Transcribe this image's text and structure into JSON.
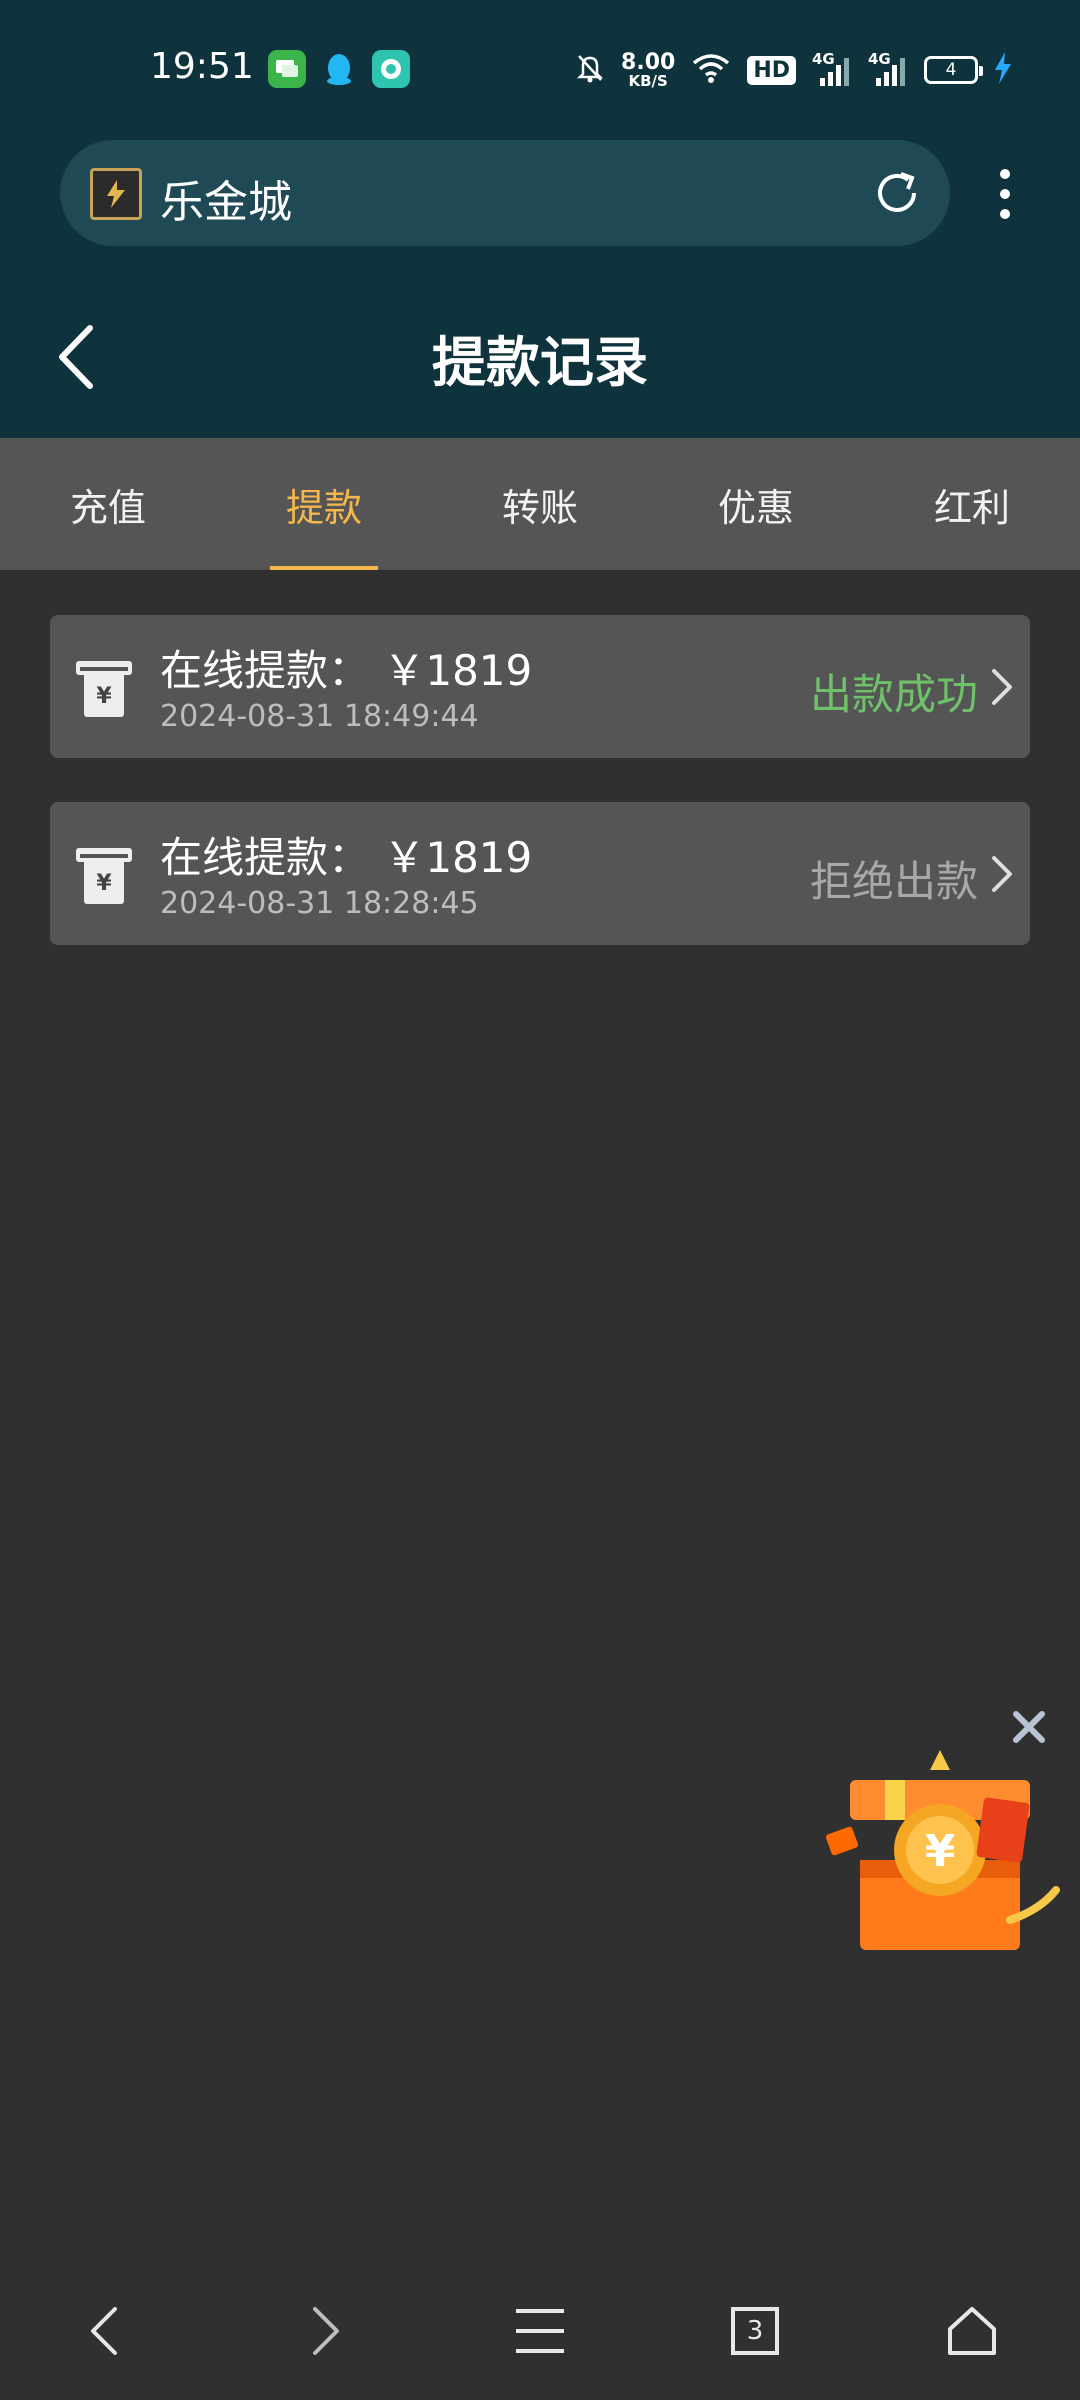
{
  "status_bar": {
    "time": "19:51",
    "net_speed_value": "8.00",
    "net_speed_unit": "KB/S",
    "hd_label": "HD",
    "sim1_label": "4G",
    "sim2_label": "4G",
    "battery": "4",
    "notification_icons": [
      "message-app-icon",
      "qq-icon",
      "chat-app-icon"
    ]
  },
  "browser": {
    "site_name": "乐金城",
    "tab_count": "3"
  },
  "page": {
    "title": "提款记录"
  },
  "tabs": [
    {
      "label": "充值",
      "active": false
    },
    {
      "label": "提款",
      "active": true
    },
    {
      "label": "转账",
      "active": false
    },
    {
      "label": "优惠",
      "active": false
    },
    {
      "label": "红利",
      "active": false
    }
  ],
  "records": [
    {
      "title": "在线提款： ￥1819",
      "datetime": "2024-08-31 18:49:44",
      "status": "出款成功"
    },
    {
      "title": "在线提款： ￥1819",
      "datetime": "2024-08-31 18:28:45",
      "status": "拒绝出款"
    }
  ],
  "colors": {
    "header_bg": "#0e333c",
    "tab_active": "#f3b74b",
    "status_success": "#6fc16a",
    "status_rejected": "#a8a8a8",
    "page_bg": "#303030",
    "card_bg": "#555555"
  }
}
